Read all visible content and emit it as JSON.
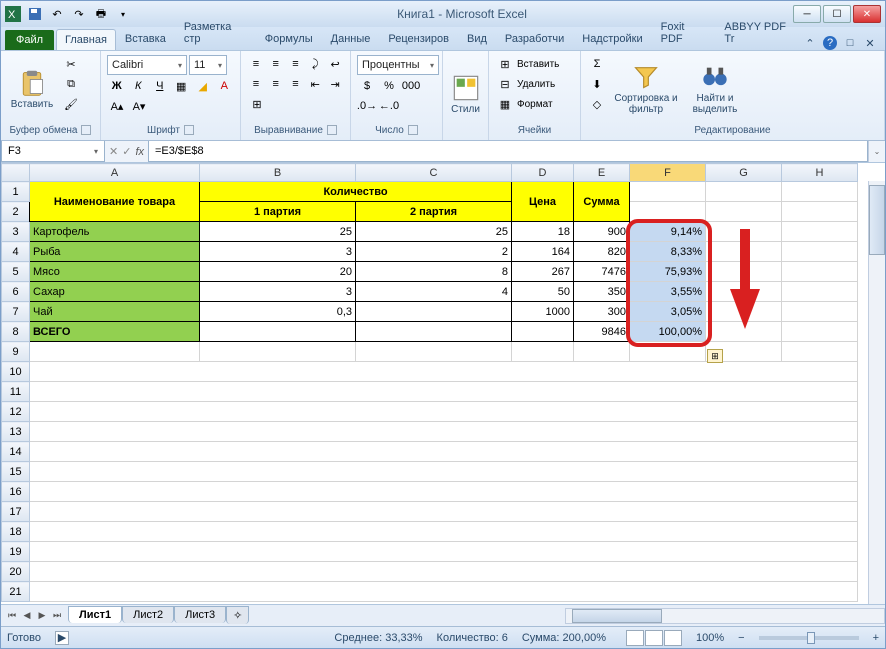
{
  "window": {
    "title": "Книга1 - Microsoft Excel"
  },
  "ribbon": {
    "file": "Файл",
    "tabs": [
      "Главная",
      "Вставка",
      "Разметка стр",
      "Формулы",
      "Данные",
      "Рецензиров",
      "Вид",
      "Разработчи",
      "Надстройки",
      "Foxit PDF",
      "ABBYY PDF Tr"
    ],
    "active": 0,
    "clipboard": {
      "paste": "Вставить",
      "label": "Буфер обмена"
    },
    "font": {
      "name": "Calibri",
      "size": "11",
      "bold": "Ж",
      "italic": "К",
      "underline": "Ч",
      "label": "Шрифт"
    },
    "alignment": {
      "label": "Выравнивание"
    },
    "number": {
      "format": "Процентны",
      "label": "Число"
    },
    "styles": {
      "btn": "Стили"
    },
    "cells": {
      "insert": "Вставить",
      "delete": "Удалить",
      "format": "Формат",
      "label": "Ячейки"
    },
    "editing": {
      "sort": "Сортировка и фильтр",
      "find": "Найти и выделить",
      "label": "Редактирование"
    }
  },
  "formula_bar": {
    "name_box": "F3",
    "formula": "=E3/$E$8"
  },
  "headers": {
    "name": "Наименование товара",
    "qty": "Количество",
    "p1": "1 партия",
    "p2": "2 партия",
    "price": "Цена",
    "sum": "Сумма"
  },
  "rows": [
    {
      "name": "Картофель",
      "p1": "25",
      "p2": "25",
      "price": "18",
      "sum": "900",
      "pct": "9,14%"
    },
    {
      "name": "Рыба",
      "p1": "3",
      "p2": "2",
      "price": "164",
      "sum": "820",
      "pct": "8,33%"
    },
    {
      "name": "Мясо",
      "p1": "20",
      "p2": "8",
      "price": "267",
      "sum": "7476",
      "pct": "75,93%"
    },
    {
      "name": "Сахар",
      "p1": "3",
      "p2": "4",
      "price": "50",
      "sum": "350",
      "pct": "3,55%"
    },
    {
      "name": "Чай",
      "p1": "0,3",
      "p2": "",
      "price": "1000",
      "sum": "300",
      "pct": "3,05%"
    }
  ],
  "total": {
    "name": "ВСЕГО",
    "sum": "9846",
    "pct": "100,00%"
  },
  "sheets": [
    "Лист1",
    "Лист2",
    "Лист3"
  ],
  "active_sheet": 0,
  "status": {
    "mode": "Готово",
    "avg_label": "Среднее:",
    "avg": "33,33%",
    "count_label": "Количество:",
    "count": "6",
    "sum_label": "Сумма:",
    "sum": "200,00%",
    "zoom": "100%"
  },
  "cols": [
    "A",
    "B",
    "C",
    "D",
    "E",
    "F",
    "G",
    "H"
  ]
}
